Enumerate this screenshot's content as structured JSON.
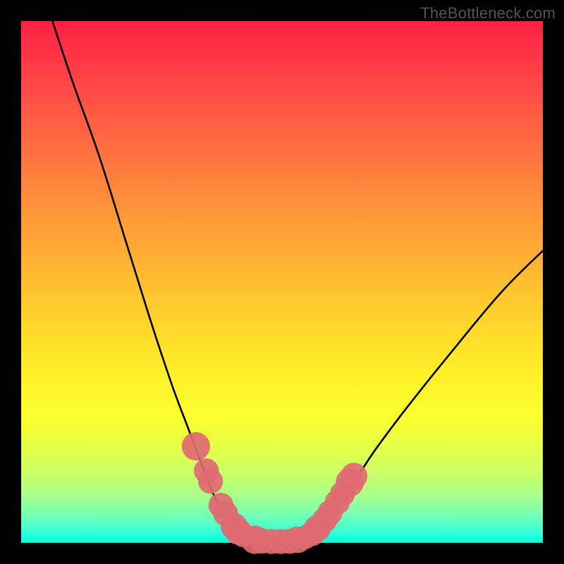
{
  "watermark": "TheBottleneck.com",
  "chart_data": {
    "type": "line",
    "title": "",
    "xlabel": "",
    "ylabel": "",
    "xlim": [
      0,
      100
    ],
    "ylim": [
      0,
      100
    ],
    "grid": false,
    "legend": false,
    "series": [
      {
        "name": "bottleneck-curve-left",
        "x": [
          6,
          10,
          15,
          20,
          25,
          29,
          32,
          35,
          37,
          39,
          40.5,
          42,
          43.5,
          45
        ],
        "y": [
          100,
          88,
          74,
          58,
          42,
          30,
          22,
          14,
          9,
          5.5,
          3.5,
          2,
          1,
          0.5
        ]
      },
      {
        "name": "bottleneck-curve-flat",
        "x": [
          45,
          47,
          49,
          51,
          53
        ],
        "y": [
          0.5,
          0.2,
          0.2,
          0.2,
          0.5
        ]
      },
      {
        "name": "bottleneck-curve-right",
        "x": [
          53,
          55,
          57,
          59,
          61,
          64,
          68,
          74,
          82,
          92,
          100
        ],
        "y": [
          0.5,
          1,
          2.5,
          5,
          8,
          12,
          18,
          26,
          36,
          48,
          56
        ]
      }
    ],
    "markers": {
      "name": "highlight-dots",
      "color": "#e06a72",
      "points": [
        {
          "x": 33.5,
          "y": 18.5,
          "r": 1.7
        },
        {
          "x": 35.5,
          "y": 13.8,
          "r": 1.5
        },
        {
          "x": 36.3,
          "y": 11.8,
          "r": 1.5
        },
        {
          "x": 38.3,
          "y": 7.2,
          "r": 1.5
        },
        {
          "x": 39.2,
          "y": 5.6,
          "r": 1.5
        },
        {
          "x": 40.8,
          "y": 3.2,
          "r": 1.6
        },
        {
          "x": 41.6,
          "y": 2.2,
          "r": 1.6
        },
        {
          "x": 42.6,
          "y": 1.4,
          "r": 1.4
        },
        {
          "x": 44.8,
          "y": 0.6,
          "r": 1.7
        },
        {
          "x": 46.2,
          "y": 0.35,
          "r": 1.5
        },
        {
          "x": 48.0,
          "y": 0.25,
          "r": 1.5
        },
        {
          "x": 49.8,
          "y": 0.25,
          "r": 1.5
        },
        {
          "x": 51.5,
          "y": 0.3,
          "r": 1.5
        },
        {
          "x": 53.0,
          "y": 0.6,
          "r": 1.6
        },
        {
          "x": 54.4,
          "y": 1.0,
          "r": 1.4
        },
        {
          "x": 55.8,
          "y": 1.8,
          "r": 1.5
        },
        {
          "x": 56.8,
          "y": 2.8,
          "r": 1.6
        },
        {
          "x": 58.2,
          "y": 4.4,
          "r": 1.5
        },
        {
          "x": 59.2,
          "y": 5.8,
          "r": 1.5
        },
        {
          "x": 60.6,
          "y": 7.8,
          "r": 1.5
        },
        {
          "x": 61.6,
          "y": 9.4,
          "r": 1.5
        },
        {
          "x": 63.0,
          "y": 11.6,
          "r": 1.7
        },
        {
          "x": 63.8,
          "y": 12.8,
          "r": 1.6
        }
      ]
    },
    "background_gradient": {
      "top": "#ff1f44",
      "bottom": "#00ffd0"
    }
  }
}
